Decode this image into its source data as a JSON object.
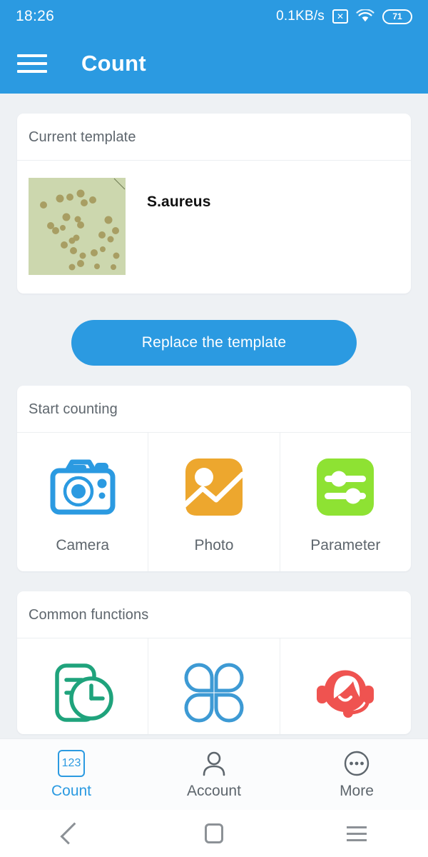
{
  "status_bar": {
    "time": "18:26",
    "network_speed": "0.1KB/s",
    "mute_icon": "x-box-icon",
    "wifi_icon": "wifi-icon",
    "battery_level": "71"
  },
  "app_bar": {
    "menu_icon": "hamburger-menu-icon",
    "title": "Count"
  },
  "current_template": {
    "header": "Current template",
    "thumbnail_alt": "petri-dish-colonies-thumbnail",
    "name": "S.aureus",
    "replace_button": "Replace the template"
  },
  "start_counting": {
    "header": "Start counting",
    "items": [
      {
        "label": "Camera",
        "icon": "camera-icon",
        "color": "#2b9ae1"
      },
      {
        "label": "Photo",
        "icon": "photo-image-icon",
        "color": "#eda72e"
      },
      {
        "label": "Parameter",
        "icon": "sliders-icon",
        "color": "#8ee233"
      }
    ]
  },
  "common_functions": {
    "header": "Common functions",
    "items": [
      {
        "label": "",
        "icon": "history-record-icon",
        "color": "#1fa37c"
      },
      {
        "label": "",
        "icon": "four-petal-grid-icon",
        "color": "#3d9ad4"
      },
      {
        "label": "",
        "icon": "customer-service-headset-icon",
        "color": "#ef5350"
      }
    ]
  },
  "tab_bar": {
    "tabs": [
      {
        "label": "Count",
        "icon": "123-box-icon",
        "active": true
      },
      {
        "label": "Account",
        "icon": "person-icon",
        "active": false
      },
      {
        "label": "More",
        "icon": "ellipsis-circle-icon",
        "active": false
      }
    ]
  },
  "nav_bar": {
    "back_icon": "back-chevron-icon",
    "home_icon": "home-square-icon",
    "recents_icon": "recents-lines-icon"
  },
  "colors": {
    "brand_blue": "#2b9ae1",
    "page_background": "#eef1f4",
    "card_background": "#ffffff",
    "muted_text": "#5e666d",
    "agar_green": "#ccd7ae",
    "colony_olive": "#a59a5d"
  }
}
